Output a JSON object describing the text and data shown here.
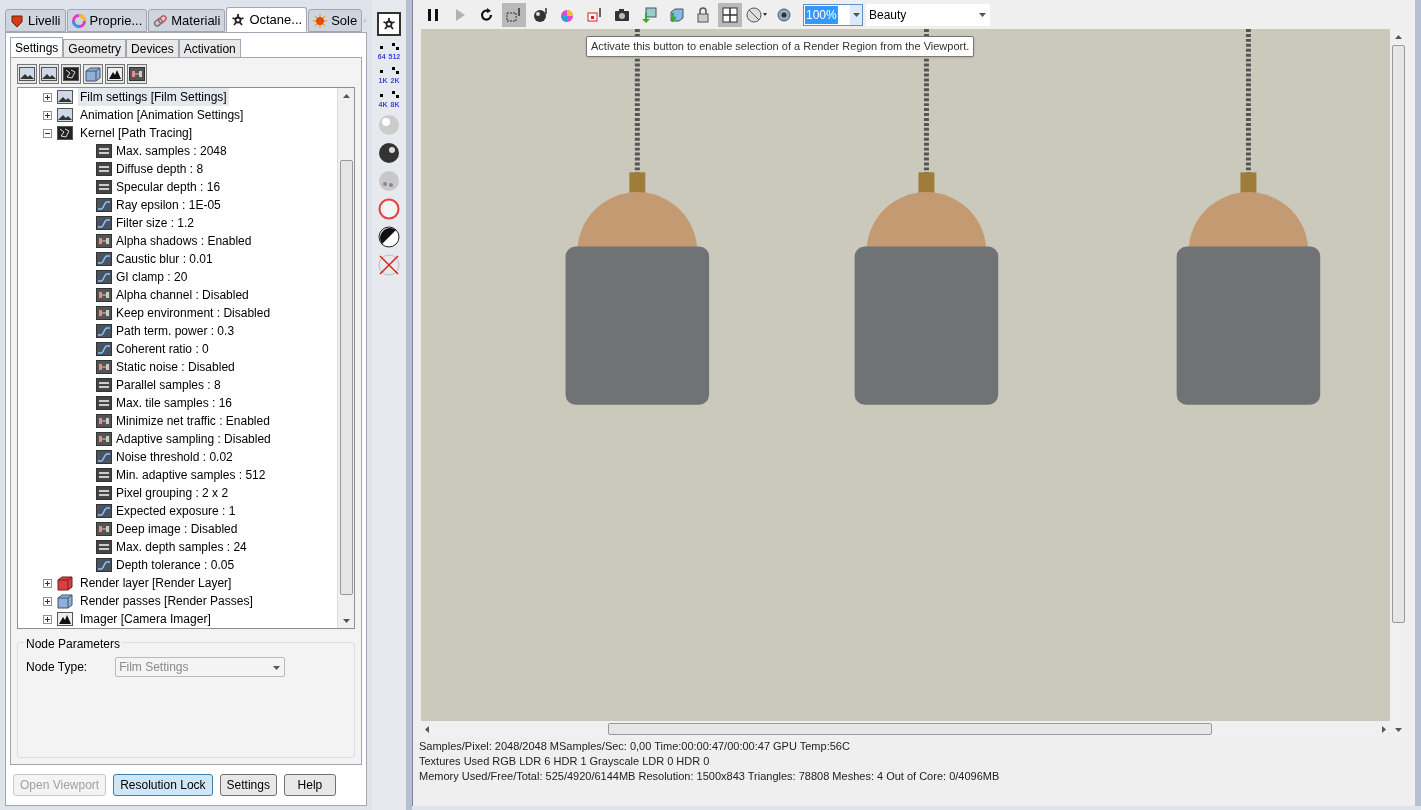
{
  "panel_tabs": [
    {
      "label": "Livelli",
      "selected": false
    },
    {
      "label": "Proprie...",
      "selected": false
    },
    {
      "label": "Materiali",
      "selected": false
    },
    {
      "label": "Octane...",
      "selected": true
    },
    {
      "label": "Sole",
      "selected": false
    }
  ],
  "sub_tabs": [
    {
      "label": "Settings",
      "selected": true
    },
    {
      "label": "Geometry",
      "selected": false
    },
    {
      "label": "Devices",
      "selected": false
    },
    {
      "label": "Activation",
      "selected": false
    }
  ],
  "tree": [
    {
      "label": "Film settings  [Film Settings]",
      "kind": "film",
      "expanded": false,
      "selected": true
    },
    {
      "label": "Animation  [Animation Settings]",
      "kind": "film",
      "expanded": false,
      "selected": false
    },
    {
      "label": "Kernel  [Path Tracing]",
      "kind": "kernel",
      "expanded": true,
      "selected": false,
      "children": [
        {
          "label": "Max. samples : 2048",
          "kind": "int"
        },
        {
          "label": "Diffuse depth : 8",
          "kind": "int"
        },
        {
          "label": "Specular depth : 16",
          "kind": "int"
        },
        {
          "label": "Ray epsilon : 1E-05",
          "kind": "float"
        },
        {
          "label": "Filter size : 1.2",
          "kind": "float"
        },
        {
          "label": "Alpha shadows : Enabled",
          "kind": "bool"
        },
        {
          "label": "Caustic blur : 0.01",
          "kind": "float"
        },
        {
          "label": "GI clamp : 20",
          "kind": "float"
        },
        {
          "label": "Alpha channel : Disabled",
          "kind": "bool"
        },
        {
          "label": "Keep environment : Disabled",
          "kind": "bool"
        },
        {
          "label": "Path term. power : 0.3",
          "kind": "float"
        },
        {
          "label": "Coherent ratio : 0",
          "kind": "float"
        },
        {
          "label": "Static noise : Disabled",
          "kind": "bool"
        },
        {
          "label": "Parallel samples : 8",
          "kind": "int"
        },
        {
          "label": "Max. tile samples : 16",
          "kind": "int"
        },
        {
          "label": "Minimize net traffic : Enabled",
          "kind": "bool"
        },
        {
          "label": "Adaptive sampling : Disabled",
          "kind": "bool"
        },
        {
          "label": "Noise threshold : 0.02",
          "kind": "float"
        },
        {
          "label": "Min. adaptive samples : 512",
          "kind": "int"
        },
        {
          "label": "Pixel grouping : 2 x 2",
          "kind": "int"
        },
        {
          "label": "Expected exposure : 1",
          "kind": "float"
        },
        {
          "label": "Deep image : Disabled",
          "kind": "bool"
        },
        {
          "label": "Max. depth samples : 24",
          "kind": "int"
        },
        {
          "label": "Depth tolerance : 0.05",
          "kind": "float"
        }
      ]
    },
    {
      "label": "Render layer  [Render Layer]",
      "kind": "layer",
      "expanded": false,
      "selected": false
    },
    {
      "label": "Render passes  [Render Passes]",
      "kind": "passes",
      "expanded": false,
      "selected": false
    },
    {
      "label": "Imager  [Camera Imager]",
      "kind": "imager",
      "expanded": false,
      "selected": false
    }
  ],
  "node_parameters": {
    "title": "Node Parameters",
    "label": "Node Type:",
    "value": "Film Settings"
  },
  "bottom_buttons": [
    {
      "label": "Open Viewport",
      "disabled": true,
      "focused": false
    },
    {
      "label": "Resolution Lock",
      "disabled": false,
      "focused": true
    },
    {
      "label": "Settings",
      "disabled": false,
      "focused": false
    },
    {
      "label": "Help",
      "disabled": false,
      "focused": false
    }
  ],
  "side_strip": [
    {
      "kind": "logo"
    },
    {
      "kind": "res",
      "a": "64",
      "b": "512"
    },
    {
      "kind": "res",
      "a": "1K",
      "b": "2K"
    },
    {
      "kind": "res",
      "a": "4K",
      "b": "8K"
    },
    {
      "kind": "sphere"
    },
    {
      "kind": "sphere-dark"
    },
    {
      "kind": "sphere-grey"
    },
    {
      "kind": "sphere-red"
    },
    {
      "kind": "contrast"
    },
    {
      "kind": "cross"
    }
  ],
  "toolbar": [
    {
      "pressed": false,
      "disabled": false
    },
    {
      "pressed": false,
      "disabled": true
    },
    {
      "pressed": false,
      "disabled": false
    },
    {
      "pressed": true,
      "disabled": false
    },
    {
      "pressed": false,
      "disabled": false
    },
    {
      "pressed": false,
      "disabled": false
    },
    {
      "pressed": false,
      "disabled": false
    },
    {
      "pressed": false,
      "disabled": false
    },
    {
      "pressed": false,
      "disabled": false
    },
    {
      "pressed": false,
      "disabled": false
    },
    {
      "pressed": false,
      "disabled": false
    },
    {
      "pressed": true,
      "disabled": false
    },
    {
      "pressed": false,
      "disabled": false
    },
    {
      "pressed": false,
      "disabled": false
    }
  ],
  "zoom_field": {
    "value": "100%"
  },
  "pass_select": {
    "value": "Beauty"
  },
  "tooltip": "Activate this button to enable selection of a Render Region from the Viewport.",
  "status_lines": [
    "Samples/Pixel: 2048/2048  MSamples/Sec: 0,00  Time:00:00:47/00:00:47  GPU Temp:56C",
    "Textures Used RGB LDR 6  HDR 1  Grayscale LDR 0  HDR 0",
    "Memory Used/Free/Total: 525/4920/6144MB  Resolution: 1500x843  Triangles: 78808  Meshes: 4 Out of Core: 0/4096MB"
  ]
}
